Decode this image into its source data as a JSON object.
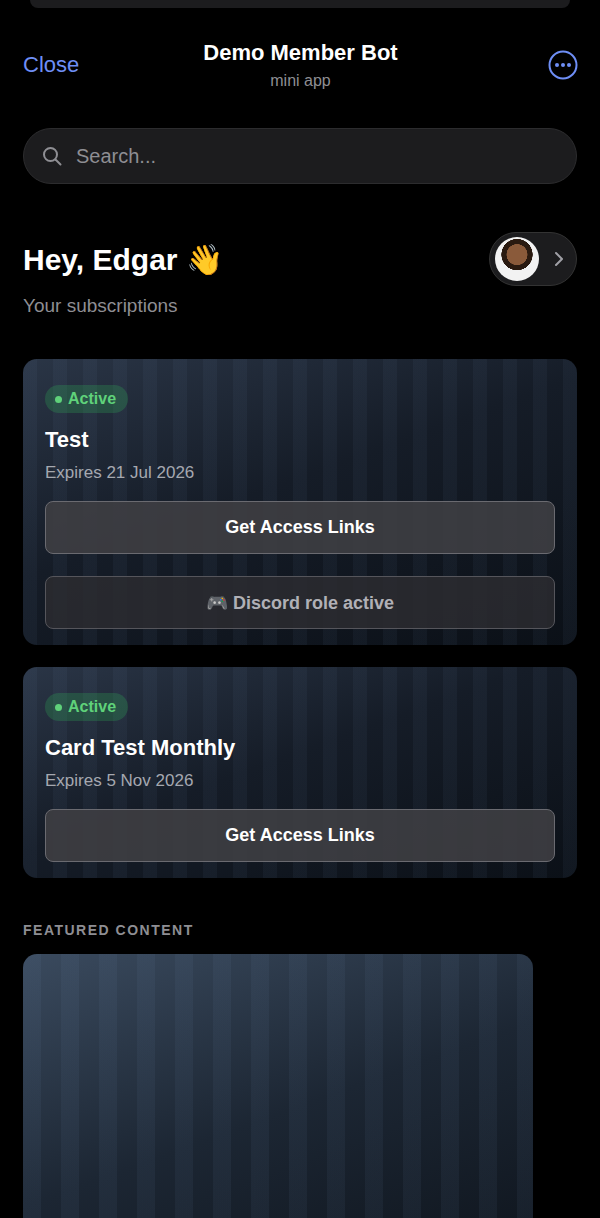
{
  "header": {
    "close": "Close",
    "title": "Demo Member Bot",
    "subtitle": "mini app"
  },
  "search": {
    "placeholder": "Search..."
  },
  "greeting": {
    "title": "Hey, Edgar 👋",
    "subtitle": "Your subscriptions"
  },
  "subscriptions": [
    {
      "status": "Active",
      "name": "Test",
      "expires": "Expires 21 Jul 2026",
      "buttons": [
        {
          "label": "Get Access Links",
          "disabled": false
        },
        {
          "label": "🎮 Discord role active",
          "disabled": true
        }
      ]
    },
    {
      "status": "Active",
      "name": "Card Test Monthly",
      "expires": "Expires 5 Nov 2026",
      "buttons": [
        {
          "label": "Get Access Links",
          "disabled": false
        }
      ]
    }
  ],
  "featured": {
    "label": "FEATURED CONTENT"
  }
}
